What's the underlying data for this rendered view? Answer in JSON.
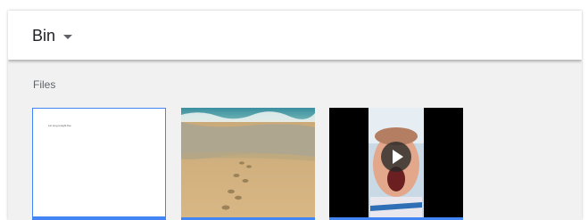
{
  "header": {
    "title": "Bin"
  },
  "section": {
    "label": "Files"
  },
  "files": [
    {
      "type": "document",
      "preview_text": "Let sing tonight five"
    },
    {
      "type": "image"
    },
    {
      "type": "video"
    }
  ],
  "colors": {
    "accent": "#4285f4",
    "background": "#f1f1f1"
  }
}
